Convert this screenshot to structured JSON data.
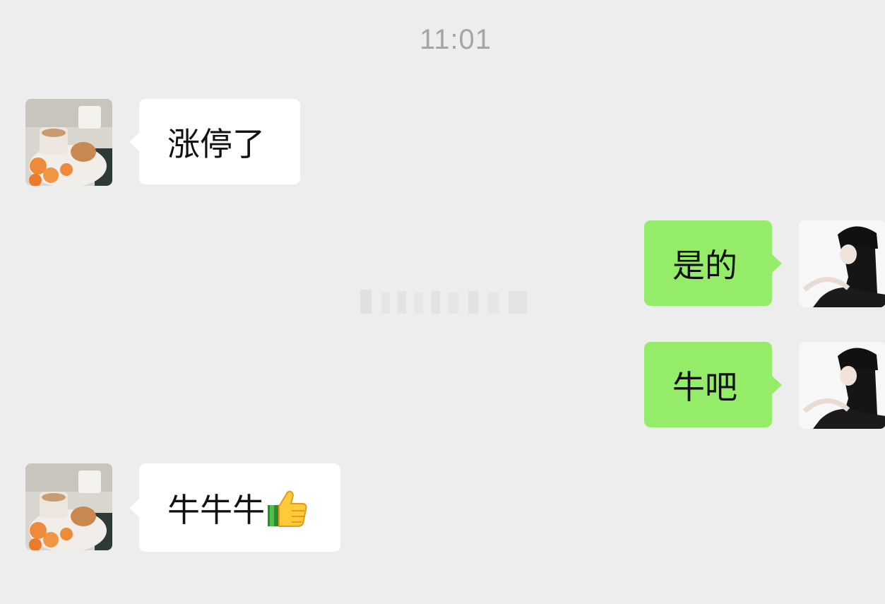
{
  "chat": {
    "timestamp": "11:01",
    "messages": [
      {
        "side": "left",
        "text": "涨停了",
        "avatar": "breakfast-photo-avatar"
      },
      {
        "side": "right",
        "text": "是的",
        "avatar": "woman-in-hat-avatar"
      },
      {
        "side": "right",
        "text": "牛吧",
        "avatar": "woman-in-hat-avatar"
      },
      {
        "side": "left",
        "text": "牛牛牛",
        "emoji": "thumbs-up-icon",
        "avatar": "breakfast-photo-avatar"
      }
    ]
  },
  "colors": {
    "background": "#ededed",
    "incoming_bubble": "#ffffff",
    "outgoing_bubble": "#95ec69",
    "timestamp": "#a5a5a5"
  }
}
